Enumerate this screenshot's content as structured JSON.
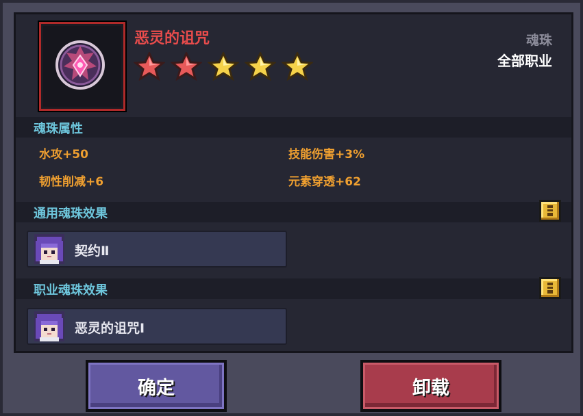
{
  "item": {
    "name": "恶灵的诅咒",
    "type": "魂珠",
    "class": "全部职业",
    "stars_total": 5,
    "stars_red": 2,
    "icon": "demon-soul-orb-icon"
  },
  "attributes": {
    "heading": "魂珠属性",
    "list": [
      "水攻+50",
      "技能伤害+3%",
      "韧性削减+6",
      "元素穿透+62"
    ]
  },
  "common_effect": {
    "heading": "通用魂珠效果",
    "label": "契约Ⅱ",
    "icon": "purple-hair-girl-portrait"
  },
  "class_effect": {
    "heading": "职业魂珠效果",
    "label": "恶灵的诅咒Ⅰ",
    "icon": "purple-hair-girl-portrait"
  },
  "buttons": {
    "confirm": "确定",
    "unload": "卸载"
  },
  "colors": {
    "name": "#e94c4c",
    "section_heading": "#6ec6dc",
    "attribute": "#f0a030",
    "star_red": "#e85a5a",
    "star_gold": "#f5d24a"
  }
}
